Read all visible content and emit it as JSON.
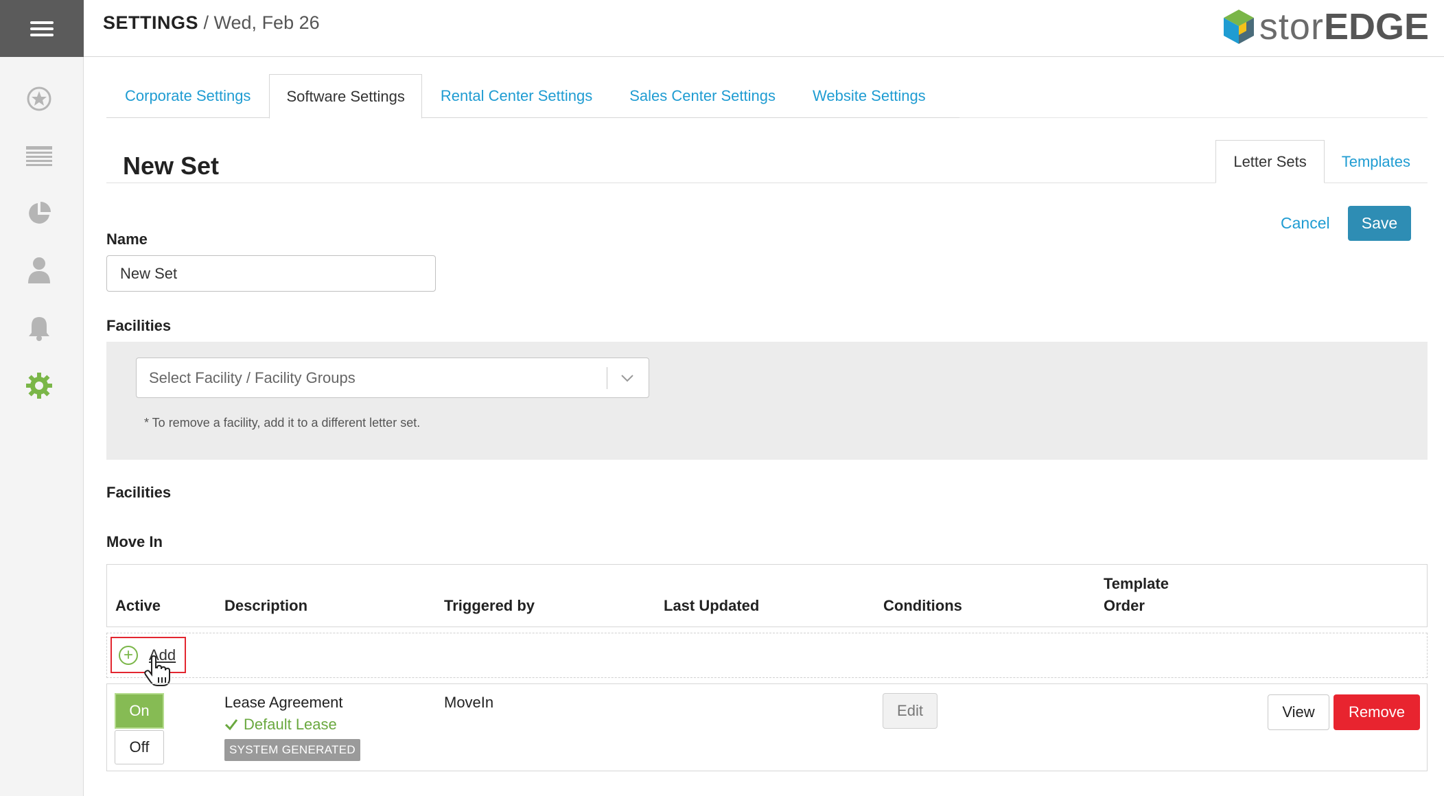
{
  "header": {
    "section": "SETTINGS",
    "separator": " / ",
    "date": "Wed, Feb 26"
  },
  "logo": {
    "prefix": "stor",
    "suffix": "EDGE"
  },
  "rail": {
    "icons": [
      "menu-icon",
      "star-icon",
      "list-icon",
      "pie-chart-icon",
      "user-icon",
      "bell-icon",
      "gear-icon"
    ]
  },
  "tabs": [
    {
      "label": "Corporate Settings"
    },
    {
      "label": "Software Settings"
    },
    {
      "label": "Rental Center Settings"
    },
    {
      "label": "Sales Center Settings"
    },
    {
      "label": "Website Settings"
    }
  ],
  "page": {
    "title": "New Set"
  },
  "subtabs": [
    {
      "label": "Letter Sets"
    },
    {
      "label": "Templates"
    }
  ],
  "actions": {
    "cancel": "Cancel",
    "save": "Save"
  },
  "form": {
    "name_label": "Name",
    "name_value": "New Set",
    "facilities_label": "Facilities",
    "facility_placeholder": "Select Facility / Facility Groups",
    "facility_note": "* To remove a facility, add it to a different letter set.",
    "facilities_heading": "Facilities",
    "move_in_heading": "Move In"
  },
  "table": {
    "columns": {
      "active": "Active",
      "description": "Description",
      "triggered_by": "Triggered by",
      "last_updated": "Last Updated",
      "conditions": "Conditions",
      "template_order_1": "Template",
      "template_order_2": "Order"
    },
    "add_label": "Add",
    "rows": [
      {
        "on": "On",
        "off": "Off",
        "description": "Lease Agreement",
        "default_label": "Default Lease",
        "badge": "SYSTEM GENERATED",
        "triggered_by": "MoveIn",
        "edit": "Edit",
        "view": "View",
        "remove": "Remove"
      }
    ]
  },
  "colors": {
    "accent_link": "#1f9cd2",
    "save": "#2e8db4",
    "on": "#86bb54",
    "remove": "#e8242f",
    "active_gear": "#7ab648"
  }
}
